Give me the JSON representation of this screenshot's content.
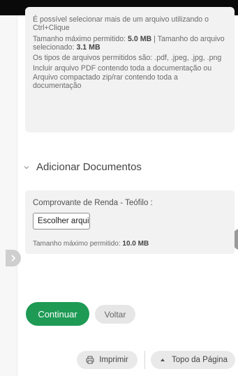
{
  "info": {
    "line1": "É possível selecionar mais de um arquivo utilizando o Ctrl+Clique",
    "max_label": "Tamanho máximo permitido:",
    "max_value": "5.0 MB",
    "sep": "|",
    "sel_label": "Tamanho do arquivo selecionado:",
    "sel_value": "3.1 MB",
    "types": "Os tipos de arquivos permitidos são: .pdf, .jpeg, .jpg, .png",
    "include": "Incluir arquivo PDF contendo toda a documentação ou Arquivo compactado zip/rar contendo toda a documentação"
  },
  "section": {
    "title": "Adicionar Documentos"
  },
  "upload": {
    "label": "Comprovante de Renda - Teófilo :",
    "file_button": "Escolher arquivo",
    "hint_label": "Tamanho máximo permitido:",
    "hint_value": "10.0 MB"
  },
  "actions": {
    "continue": "Continuar",
    "back": "Voltar"
  },
  "footer": {
    "print": "Imprimir",
    "top": "Topo da Página"
  },
  "colors": {
    "primary": "#1e9a55",
    "panel": "#f2f2f2",
    "topbar": "#0a0a0a"
  }
}
